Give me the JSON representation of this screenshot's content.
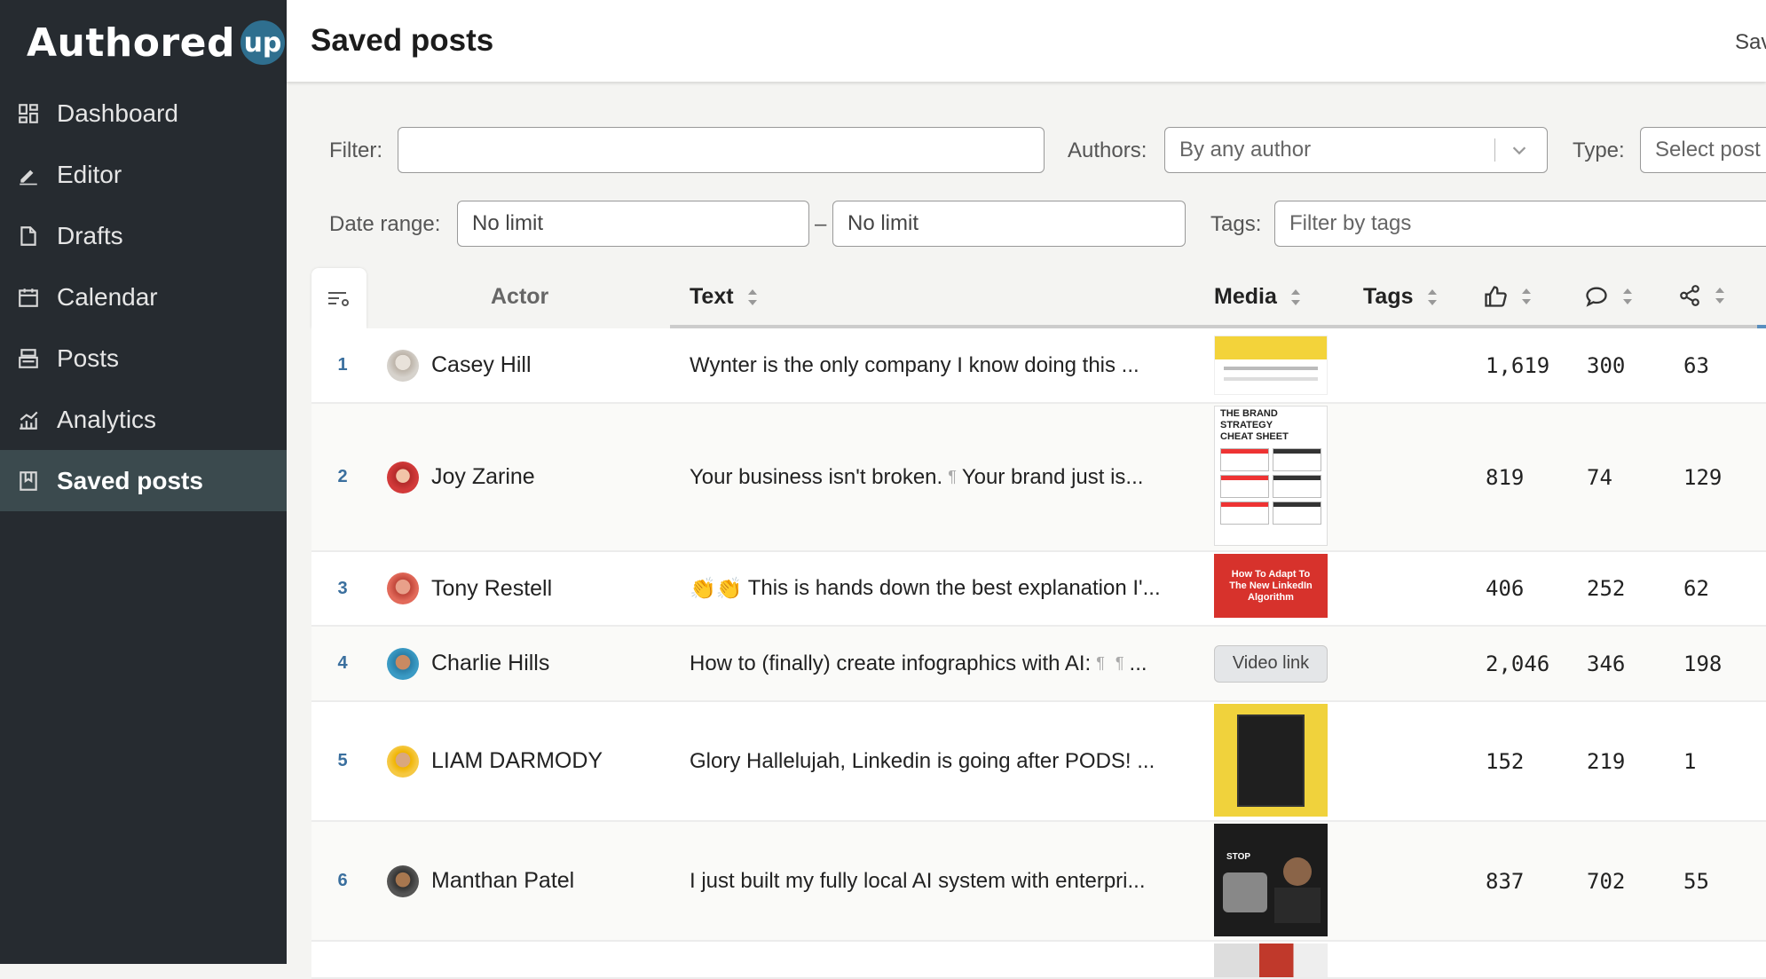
{
  "app": {
    "logo_text": "Authored",
    "logo_badge": "up"
  },
  "sidebar": {
    "items": [
      {
        "label": "Dashboard",
        "icon": "dashboard-icon"
      },
      {
        "label": "Editor",
        "icon": "pencil-icon"
      },
      {
        "label": "Drafts",
        "icon": "document-icon"
      },
      {
        "label": "Calendar",
        "icon": "calendar-icon"
      },
      {
        "label": "Posts",
        "icon": "posts-icon"
      },
      {
        "label": "Analytics",
        "icon": "analytics-icon"
      },
      {
        "label": "Saved posts",
        "icon": "bookmark-icon",
        "active": true
      }
    ]
  },
  "header": {
    "title": "Saved posts",
    "right_text": "Sav"
  },
  "filters": {
    "filter_label": "Filter:",
    "filter_value": "",
    "authors_label": "Authors:",
    "authors_value": "By any author",
    "type_label": "Type:",
    "type_value": "Select post",
    "date_label": "Date range:",
    "date_from": "No limit",
    "date_sep": "–",
    "date_to": "No limit",
    "tags_label": "Tags:",
    "tags_placeholder": "Filter by tags"
  },
  "table": {
    "columns": {
      "actor": "Actor",
      "text": "Text",
      "media": "Media",
      "tags": "Tags",
      "likes_icon": "thumbs-up-icon",
      "comments_icon": "comment-icon",
      "shares_icon": "share-icon"
    },
    "rows": [
      {
        "num": "1",
        "actor": "Casey Hill",
        "text": "Wynter is the only company I know doing this ...",
        "media": "image",
        "likes": "1,619",
        "comments": "300",
        "shares": "63"
      },
      {
        "num": "2",
        "actor": "Joy Zarine",
        "text_a": "Your business isn't broken.",
        "text_b": "Your brand just is...",
        "media": "image",
        "media_caption": "THE BRAND STRATEGY CHEAT SHEET",
        "likes": "819",
        "comments": "74",
        "shares": "129"
      },
      {
        "num": "3",
        "actor": "Tony Restell",
        "text_emoji": "👏👏",
        "text": "This is hands down the best explanation I'...",
        "media": "image",
        "media_caption": "How To Adapt To The New LinkedIn Algorithm",
        "likes": "406",
        "comments": "252",
        "shares": "62"
      },
      {
        "num": "4",
        "actor": "Charlie Hills",
        "text": "How to (finally) create infographics with AI:",
        "text_tail": "...",
        "media": "video",
        "media_label": "Video link",
        "likes": "2,046",
        "comments": "346",
        "shares": "198"
      },
      {
        "num": "5",
        "actor": "LIAM DARMODY",
        "text": "Glory Hallelujah, Linkedin is going after PODS! ...",
        "media": "image",
        "likes": "152",
        "comments": "219",
        "shares": "1"
      },
      {
        "num": "6",
        "actor": "Manthan Patel",
        "text": "I just built my fully local AI system with enterpri...",
        "media": "image",
        "media_caption": "STOP",
        "likes": "837",
        "comments": "702",
        "shares": "55"
      }
    ]
  },
  "colors": {
    "sidebar_bg": "#262b30",
    "sidebar_active": "#3b4a4e",
    "accent": "#3a6f9e",
    "logo_badge": "#2f6f8f"
  }
}
